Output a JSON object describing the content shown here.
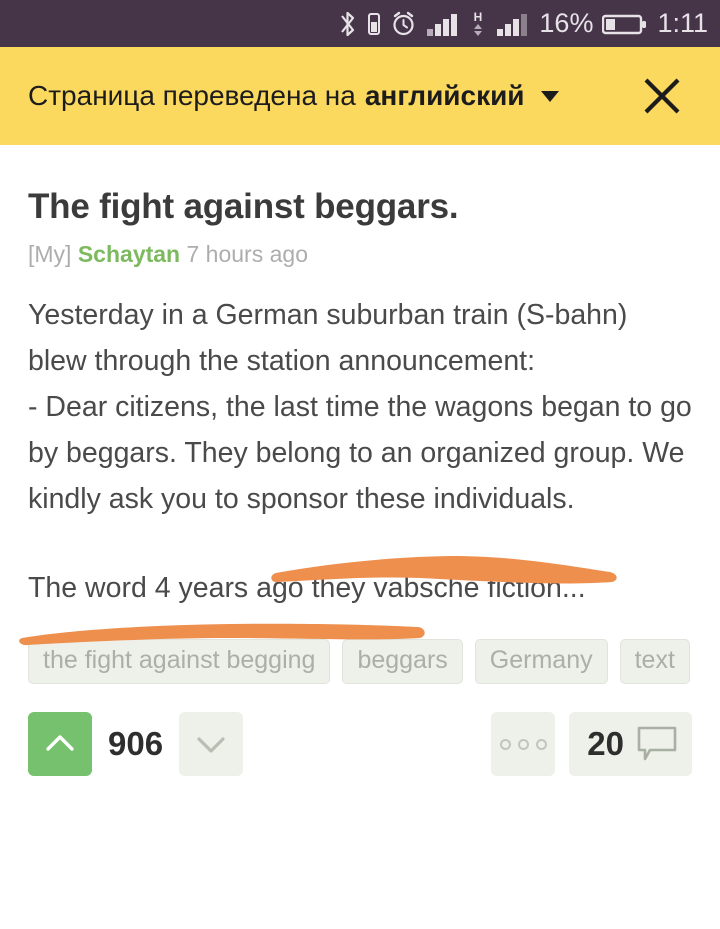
{
  "status_bar": {
    "background_color": "#463449",
    "text_color": "#e6e2e6",
    "battery_percent": "16%",
    "time": "1:11",
    "icons": [
      "bluetooth-icon",
      "vibrate-icon",
      "alarm-icon",
      "signal-bars-icon",
      "hspa-data-icon",
      "signal-bars-secondary-icon",
      "battery-icon"
    ]
  },
  "translate_banner": {
    "background_color": "#fbd95f",
    "text_prefix": "Страница переведена на",
    "language": "английский",
    "dropdown_icon": "chevron-down-icon",
    "close_icon": "close-icon"
  },
  "post": {
    "title": "The fight against beggars.",
    "meta_prefix": "[My]",
    "author": "Schaytan",
    "author_color": "#7cb95f",
    "timestamp": "7 hours ago",
    "body": "Yesterday in a German suburban train (S-bahn) blew through the station announcement:\n- Dear citizens, the last time the wagons began to go by beggars. They belong to an organized group. We kindly ask you to sponsor these individuals.",
    "excerpt": "The word 4 years ago they vabsche fiction...",
    "tags": [
      "the fight against begging",
      "beggars",
      "Germany",
      "text"
    ]
  },
  "annotations": {
    "color": "#ee8f4e",
    "strokes": [
      {
        "name": "highlight-stroke-upper"
      },
      {
        "name": "highlight-stroke-lower"
      }
    ]
  },
  "actions": {
    "upvote_icon": "chevron-up-icon",
    "upvote_color": "#76c16d",
    "score": "906",
    "downvote_icon": "chevron-down-icon",
    "more_icon": "more-dots-icon",
    "comments_count": "20",
    "comments_icon": "comment-bubble-icon"
  }
}
